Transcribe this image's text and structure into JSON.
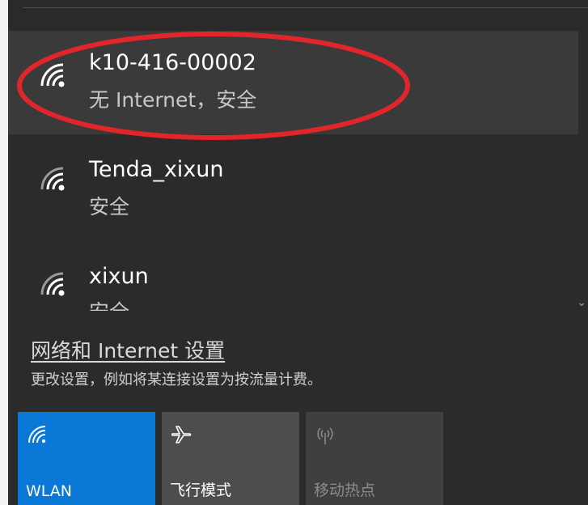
{
  "networks": [
    {
      "name": "k10-416-00002",
      "status": "无 Internet，安全",
      "icon": "wifi-secured-icon",
      "selected": true
    },
    {
      "name": "Tenda_xixun",
      "status": "安全",
      "icon": "wifi-secured-icon",
      "selected": false
    },
    {
      "name": "xixun",
      "status": "安全",
      "icon": "wifi-secured-icon",
      "selected": false
    }
  ],
  "settings": {
    "link_label": "网络和 Internet 设置",
    "description": "更改设置，例如将某连接设置为按流量计费。"
  },
  "quick_actions": [
    {
      "label": "WLAN",
      "icon": "wifi-icon",
      "state": "on"
    },
    {
      "label": "飞行模式",
      "icon": "airplane-icon",
      "state": "off"
    },
    {
      "label": "移动热点",
      "icon": "hotspot-icon",
      "state": "disabled"
    }
  ],
  "colors": {
    "accent": "#0a78d7",
    "panel_bg": "#2b2b2b",
    "selected_bg": "#3a3a3a",
    "annotation": "#e0262b"
  }
}
